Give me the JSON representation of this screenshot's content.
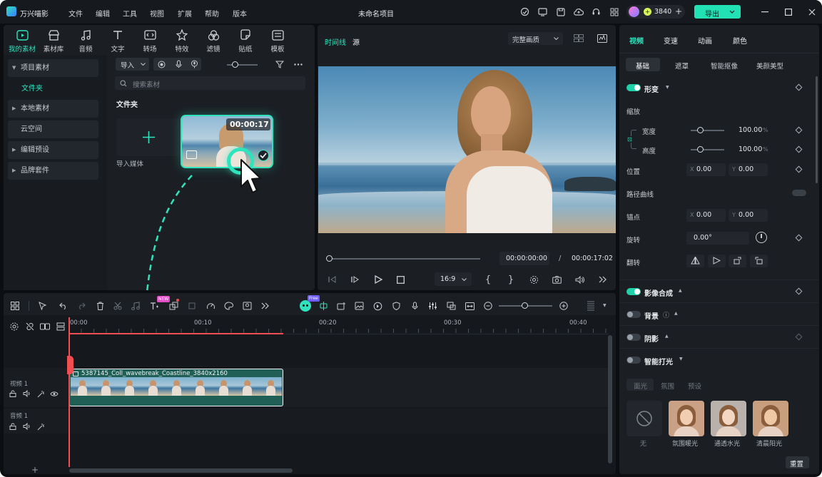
{
  "app": {
    "name": "万兴喵影",
    "project_title": "未命名项目",
    "credits": "3840",
    "export_label": "导出"
  },
  "menu": [
    "文件",
    "编辑",
    "工具",
    "视图",
    "扩展",
    "帮助",
    "版本"
  ],
  "nav_tabs": [
    {
      "label": "我的素材",
      "icon": "folder-play-icon"
    },
    {
      "label": "素材库",
      "icon": "store-icon"
    },
    {
      "label": "音频",
      "icon": "music-note-icon"
    },
    {
      "label": "文字",
      "icon": "text-icon"
    },
    {
      "label": "转场",
      "icon": "transition-icon"
    },
    {
      "label": "特效",
      "icon": "effects-icon"
    },
    {
      "label": "滤镜",
      "icon": "filter-icon"
    },
    {
      "label": "贴纸",
      "icon": "sticker-icon"
    },
    {
      "label": "模板",
      "icon": "template-icon"
    }
  ],
  "tree": [
    {
      "label": "项目素材",
      "expanded": true
    },
    {
      "label": "文件夹",
      "selected": true
    },
    {
      "label": "本地素材"
    },
    {
      "label": "云空间"
    },
    {
      "label": "编辑预设"
    },
    {
      "label": "品牌套件"
    }
  ],
  "media": {
    "import_label": "导入",
    "search_placeholder": "搜索素材",
    "folder_title": "文件夹",
    "import_media_label": "导入媒体",
    "clip_duration": "00:00:17"
  },
  "preview": {
    "tab_timeline": "时间线",
    "tab_source": "源",
    "quality": "完整画质",
    "current_time": "00:00:00:00",
    "separator": "/",
    "total_time": "00:00:17:02",
    "aspect": "16:9",
    "progress": 0
  },
  "timeline": {
    "new_badge_a": "NEW",
    "new_badge_b": "Free",
    "ruler": [
      "00:00",
      "00:10",
      "00:20",
      "00:30",
      "00:40"
    ],
    "clip_name": "5387145_Coll_wavebreak_Coastline_3840x2160",
    "video_track": "视频 1",
    "audio_track": "音频 1"
  },
  "inspector": {
    "tabs": [
      "视频",
      "变速",
      "动画",
      "颜色"
    ],
    "subtabs": [
      "基础",
      "遮罩",
      "智能抠像",
      "美颜美型"
    ],
    "transform": "形变",
    "scale": "缩放",
    "width": "宽度",
    "width_value": "100.00",
    "height": "高度",
    "height_value": "100.00",
    "percent": "%",
    "position": "位置",
    "x_label": "X",
    "y_label": "Y",
    "pos_x": "0.00",
    "pos_y": "0.00",
    "path_curve": "路径曲线",
    "anchor": "锚点",
    "anchor_x": "0.00",
    "anchor_y": "0.00",
    "rotation": "旋转",
    "rotation_value": "0.00°",
    "flip": "翻转",
    "compositing": "影像合成",
    "background": "背景",
    "shadow": "阴影",
    "smart_light": "智能打光",
    "light_tabs": [
      "面光",
      "氛围",
      "预设"
    ],
    "presets": [
      "无",
      "氛围暖光",
      "通透水光",
      "清晨阳光"
    ],
    "reset": "重置"
  },
  "colors": {
    "accent": "#2fe3bd",
    "export": "#21e1b5",
    "playhead": "#f04e52",
    "clip": "#1f5f56"
  }
}
